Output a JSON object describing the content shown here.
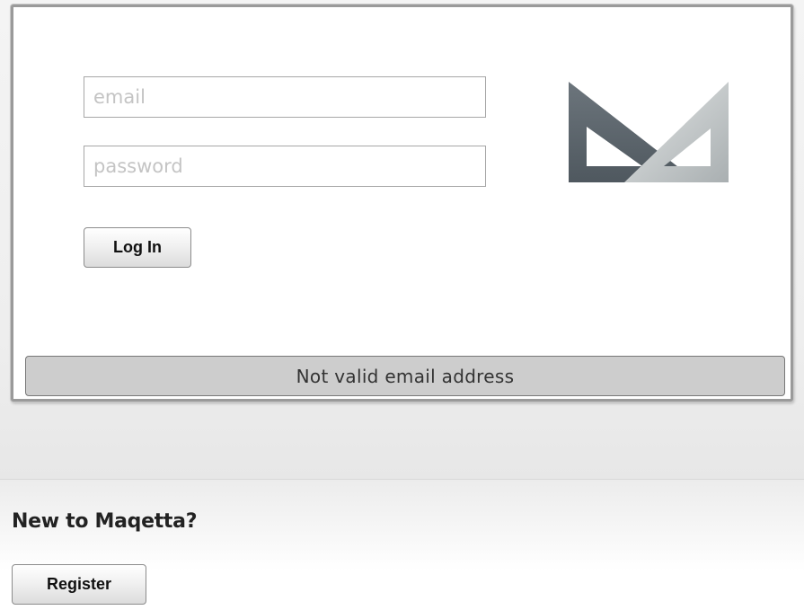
{
  "login": {
    "email_placeholder": "email",
    "password_placeholder": "password",
    "login_label": "Log In",
    "status_message": "Not valid email address"
  },
  "register": {
    "heading": "New to Maqetta?",
    "button_label": "Register"
  },
  "logo": {
    "icon": "maqetta-logo-icon",
    "colors": {
      "dark": "#5d666d",
      "light": "#b8bdbe"
    }
  },
  "colors": {
    "panel_border": "#9a9a9a",
    "status_bg": "#cdcdcd",
    "page_bg": "#eeeeee"
  }
}
